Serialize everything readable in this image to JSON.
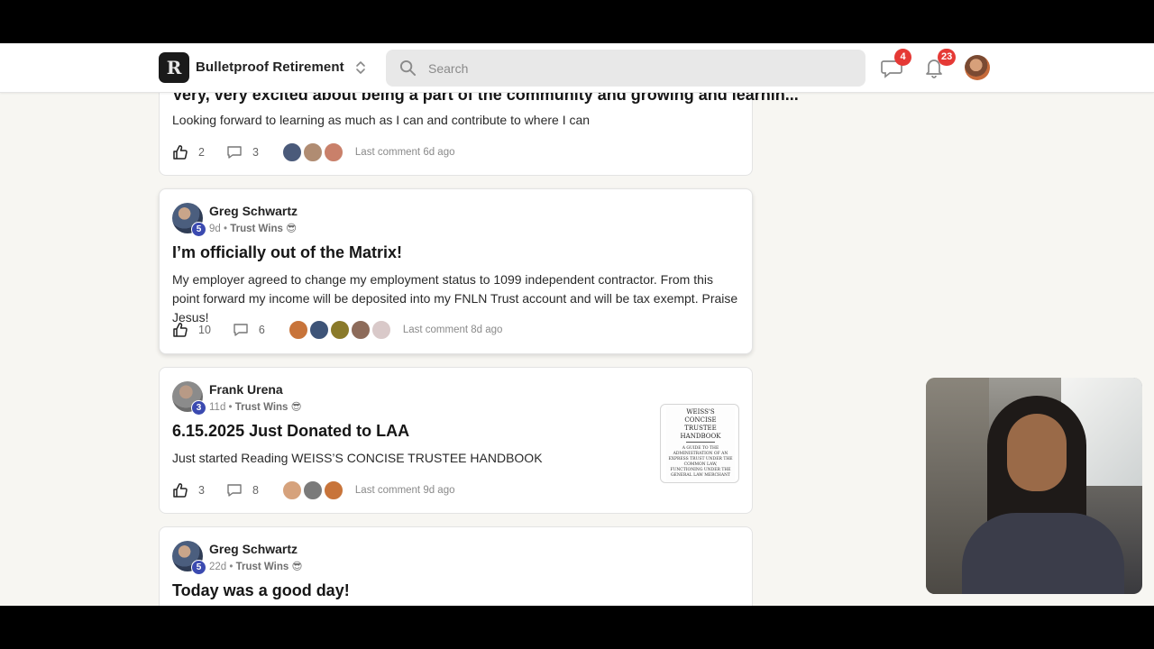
{
  "header": {
    "group_name": "Bulletproof Retirement",
    "search_placeholder": "Search",
    "chat_badge": "4",
    "notifications_badge": "23"
  },
  "posts": [
    {
      "title": "Very, very excited about being a part of the community and growing and learnin...",
      "body": "Looking forward to learning as much as I can and contribute to where I can",
      "likes": "2",
      "comments": "3",
      "last_comment": "Last comment 6d ago"
    },
    {
      "author": "Greg Schwartz",
      "level": "5",
      "age": "9d",
      "category": "Trust Wins 😎",
      "title": "I’m officially out of the Matrix!",
      "body": "My employer agreed to change my employment status to 1099 independent contractor. From this point forward my income will be deposited into my FNLN Trust account and will be tax exempt. Praise Jesus!",
      "likes": "10",
      "comments": "6",
      "last_comment": "Last comment 8d ago"
    },
    {
      "author": "Frank Urena",
      "level": "3",
      "age": "11d",
      "category": "Trust Wins 😎",
      "title": "6.15.2025 Just Donated to LAA",
      "body": "Just started Reading WEISS’S CONCISE TRUSTEE HANDBOOK",
      "likes": "3",
      "comments": "8",
      "last_comment": "Last comment 9d ago",
      "thumbnail": {
        "title": "WEISS'S CONCISE TRUSTEE HANDBOOK",
        "subtitle": "A GUIDE TO THE ADMINISTRATION OF AN EXPRESS TRUST UNDER THE COMMON LAW, FUNCTIONING UNDER THE GENERAL LAW MERCHANT"
      }
    },
    {
      "author": "Greg Schwartz",
      "level": "5",
      "age": "22d",
      "category": "Trust Wins 😎",
      "title": "Today was a good day!"
    }
  ],
  "sep": " • ",
  "colors": {
    "badge": "#e53935",
    "level_badge": "#3b4ab0",
    "search_bg": "#e8e8e8",
    "page_bg": "#f7f6f2"
  },
  "icons": [
    "search-icon",
    "chevron-updown-icon",
    "chat-icon",
    "bell-icon",
    "thumbs-up-icon",
    "comment-icon"
  ]
}
